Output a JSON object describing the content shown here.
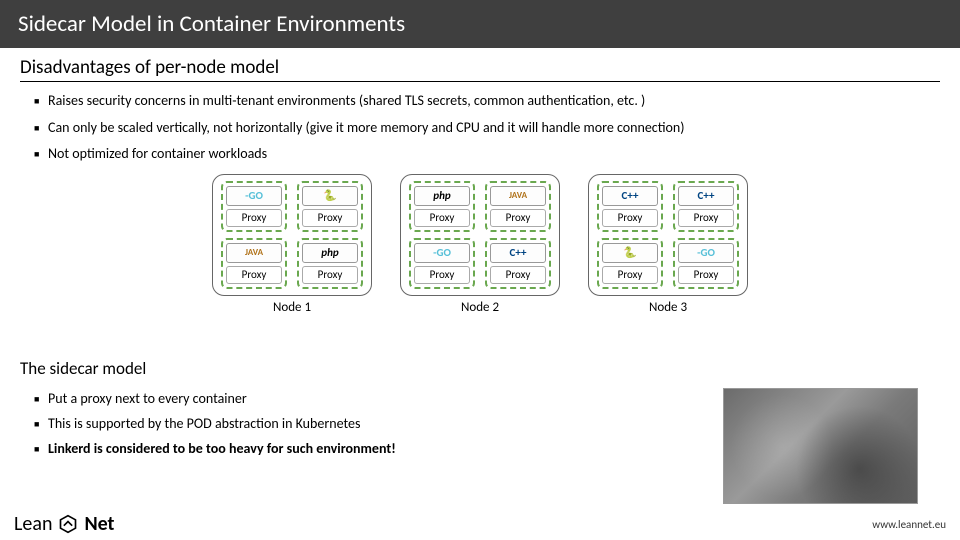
{
  "title": "Sidecar Model in Container Environments",
  "section1": {
    "heading": "Disadvantages of per-node model",
    "bullets": [
      "Raises security concerns in multi-tenant environments (shared TLS secrets, common authentication, etc. )",
      "Can only be scaled vertically, not horizontally (give it more memory and CPU and it will handle more connection)",
      "Not optimized for container workloads"
    ]
  },
  "diagram": {
    "proxy_label": "Proxy",
    "lang": {
      "go": "-GO",
      "py": "🐍",
      "php": "php",
      "java": "JAVA",
      "cpp": "C++"
    },
    "nodes": [
      {
        "label": "Node 1",
        "pods": [
          "go",
          "py",
          "java",
          "php"
        ]
      },
      {
        "label": "Node 2",
        "pods": [
          "php",
          "java",
          "go",
          "cpp"
        ]
      },
      {
        "label": "Node 3",
        "pods": [
          "cpp",
          "cpp",
          "py",
          "go"
        ]
      }
    ]
  },
  "sidecar_heading": "The sidecar model",
  "section2": {
    "bullets": [
      {
        "text": "Put a proxy next to every container",
        "heavy": false
      },
      {
        "text": "This is supported by the POD abstraction in Kubernetes",
        "heavy": false
      },
      {
        "text": "Linkerd is considered to be too heavy for such environment!",
        "heavy": true
      }
    ]
  },
  "footer": {
    "brand_thin": "Lean",
    "brand_bold": "Net",
    "url": "www.leannet.eu"
  }
}
